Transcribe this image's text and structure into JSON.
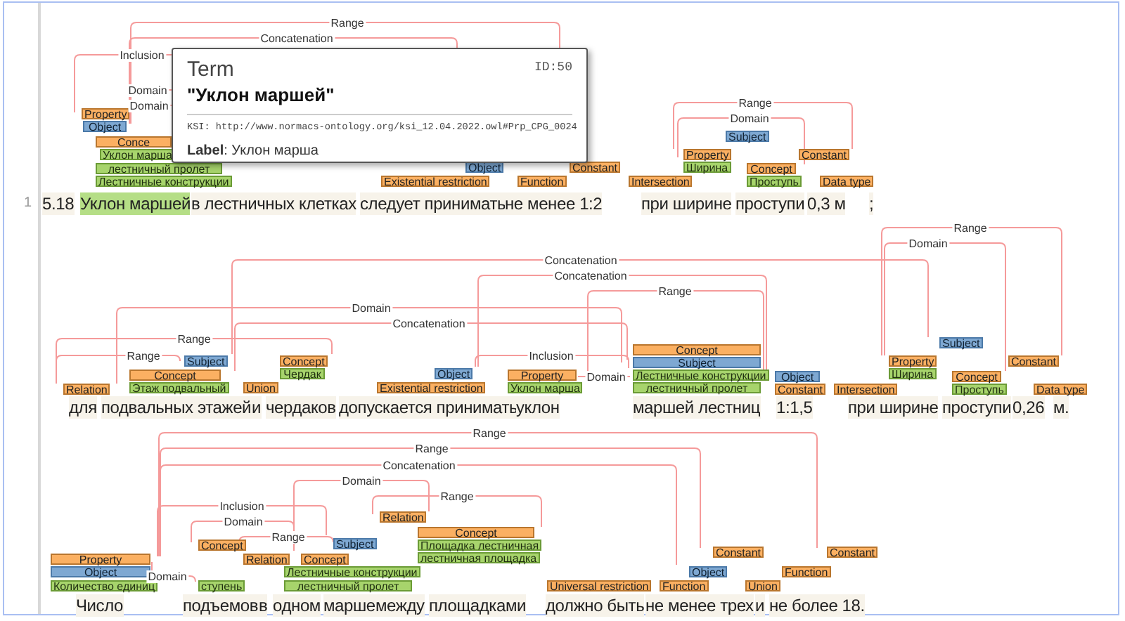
{
  "line_number": "1",
  "sentences": [
    {
      "words": [
        {
          "text": "5.18",
          "highlighted": false
        },
        {
          "text": "Уклон маршей",
          "highlighted": true
        },
        {
          "text": "в лестничных клетках",
          "highlighted": false
        },
        {
          "text": "следует принимать",
          "highlighted": false
        },
        {
          "text": "не менее 1:2",
          "highlighted": false
        },
        {
          "text": "при ширине",
          "highlighted": false
        },
        {
          "text": "проступи",
          "highlighted": false
        },
        {
          "text": "0,3 м",
          "highlighted": false
        },
        {
          "text": ";",
          "highlighted": false
        }
      ],
      "labels": [
        {
          "text": "Property",
          "kind": "entity"
        },
        {
          "text": "Object",
          "kind": "role"
        },
        {
          "text": "Subject",
          "kind": "role"
        },
        {
          "text": "Conce",
          "kind": "entity"
        },
        {
          "text": "Уклон марша",
          "kind": "term"
        },
        {
          "text": "Property",
          "kind": "entity"
        },
        {
          "text": "Constant",
          "kind": "entity"
        },
        {
          "text": "лестничный пролет",
          "kind": "term"
        },
        {
          "text": "Object",
          "kind": "role"
        },
        {
          "text": "Constant",
          "kind": "entity"
        },
        {
          "text": "Ширина",
          "kind": "term"
        },
        {
          "text": "Concept",
          "kind": "entity"
        },
        {
          "text": "Лестничные конструкции",
          "kind": "term"
        },
        {
          "text": "Existential restriction",
          "kind": "entity"
        },
        {
          "text": "Function",
          "kind": "entity"
        },
        {
          "text": "Intersection",
          "kind": "entity"
        },
        {
          "text": "Проступь",
          "kind": "term"
        },
        {
          "text": "Data type",
          "kind": "entity"
        }
      ],
      "arcs": [
        {
          "label": "Range"
        },
        {
          "label": "Concatenation"
        },
        {
          "label": "Inclusion"
        },
        {
          "label": "Domain"
        },
        {
          "label": "Range"
        },
        {
          "label": "Domain"
        },
        {
          "label": "Domain"
        }
      ]
    },
    {
      "words": [
        {
          "text": "для",
          "highlighted": false
        },
        {
          "text": "подвальных этажей",
          "highlighted": false
        },
        {
          "text": "и",
          "highlighted": false
        },
        {
          "text": "чердаков",
          "highlighted": false
        },
        {
          "text": "допускается принимать",
          "highlighted": false
        },
        {
          "text": "уклон",
          "highlighted": false
        },
        {
          "text": "маршей лестниц",
          "highlighted": false
        },
        {
          "text": "1:1,5",
          "highlighted": false
        },
        {
          "text": "при ширине",
          "highlighted": false
        },
        {
          "text": "проступи",
          "highlighted": false
        },
        {
          "text": "0,26",
          "highlighted": false
        },
        {
          "text": "м.",
          "highlighted": false
        }
      ],
      "labels": [
        {
          "text": "Subject",
          "kind": "role"
        },
        {
          "text": "Concept",
          "kind": "entity"
        },
        {
          "text": "Subject",
          "kind": "role"
        },
        {
          "text": "Concept",
          "kind": "entity"
        },
        {
          "text": "Subject",
          "kind": "role"
        },
        {
          "text": "Property",
          "kind": "entity"
        },
        {
          "text": "Constant",
          "kind": "entity"
        },
        {
          "text": "Concept",
          "kind": "entity"
        },
        {
          "text": "Чердак",
          "kind": "term"
        },
        {
          "text": "Object",
          "kind": "role"
        },
        {
          "text": "Property",
          "kind": "entity"
        },
        {
          "text": "Лестничные конструкции",
          "kind": "term"
        },
        {
          "text": "Object",
          "kind": "role"
        },
        {
          "text": "Ширина",
          "kind": "term"
        },
        {
          "text": "Concept",
          "kind": "entity"
        },
        {
          "text": "Relation",
          "kind": "entity"
        },
        {
          "text": "Этаж подвальный",
          "kind": "term"
        },
        {
          "text": "Union",
          "kind": "entity"
        },
        {
          "text": "Existential restriction",
          "kind": "entity"
        },
        {
          "text": "Уклон марша",
          "kind": "term"
        },
        {
          "text": "лестничный пролет",
          "kind": "term"
        },
        {
          "text": "Constant",
          "kind": "entity"
        },
        {
          "text": "Intersection",
          "kind": "entity"
        },
        {
          "text": "Проступь",
          "kind": "term"
        },
        {
          "text": "Data type",
          "kind": "entity"
        }
      ],
      "arcs": [
        {
          "label": "Range"
        },
        {
          "label": "Domain"
        },
        {
          "label": "Concatenation"
        },
        {
          "label": "Concatenation"
        },
        {
          "label": "Range"
        },
        {
          "label": "Domain"
        },
        {
          "label": "Concatenation"
        },
        {
          "label": "Range"
        },
        {
          "label": "Range"
        },
        {
          "label": "Inclusion"
        },
        {
          "label": "Domain"
        }
      ]
    },
    {
      "words": [
        {
          "text": "Число",
          "highlighted": false
        },
        {
          "text": "подъемов",
          "highlighted": false
        },
        {
          "text": "в",
          "highlighted": false
        },
        {
          "text": "одном",
          "highlighted": false
        },
        {
          "text": "марше",
          "highlighted": false
        },
        {
          "text": "между",
          "highlighted": false
        },
        {
          "text": "площадками",
          "highlighted": false
        },
        {
          "text": "должно быть",
          "highlighted": false
        },
        {
          "text": "не менее трех",
          "highlighted": false
        },
        {
          "text": "и",
          "highlighted": false
        },
        {
          "text": "не более 18.",
          "highlighted": false
        }
      ],
      "labels": [
        {
          "text": "Relation",
          "kind": "entity"
        },
        {
          "text": "Concept",
          "kind": "entity"
        },
        {
          "text": "Concept",
          "kind": "entity"
        },
        {
          "text": "Subject",
          "kind": "role"
        },
        {
          "text": "Площадка лестничная",
          "kind": "term"
        },
        {
          "text": "Constant",
          "kind": "entity"
        },
        {
          "text": "Constant",
          "kind": "entity"
        },
        {
          "text": "Property",
          "kind": "entity"
        },
        {
          "text": "Relation",
          "kind": "entity"
        },
        {
          "text": "Concept",
          "kind": "entity"
        },
        {
          "text": "лестничная площадка",
          "kind": "term"
        },
        {
          "text": "Object",
          "kind": "role"
        },
        {
          "text": "Лестничные конструкции",
          "kind": "term"
        },
        {
          "text": "Object",
          "kind": "role"
        },
        {
          "text": "Function",
          "kind": "entity"
        },
        {
          "text": "Количество единиц",
          "kind": "term"
        },
        {
          "text": "ступень",
          "kind": "term"
        },
        {
          "text": "лестничный пролет",
          "kind": "term"
        },
        {
          "text": "Universal restriction",
          "kind": "entity"
        },
        {
          "text": "Function",
          "kind": "entity"
        },
        {
          "text": "Union",
          "kind": "entity"
        }
      ],
      "arcs": [
        {
          "label": "Range"
        },
        {
          "label": "Range"
        },
        {
          "label": "Concatenation"
        },
        {
          "label": "Domain"
        },
        {
          "label": "Range"
        },
        {
          "label": "Inclusion"
        },
        {
          "label": "Domain"
        },
        {
          "label": "Range"
        },
        {
          "label": "Domain"
        }
      ]
    }
  ],
  "tooltip": {
    "title": "Term",
    "id": "ID:50",
    "term": "\"Уклон маршей\"",
    "ksi": "KSI: http://www.normacs-ontology.org/ksi_12.04.2022.owl#Prp_CPG_0024",
    "label": "**Label**: Уклон марша"
  }
}
